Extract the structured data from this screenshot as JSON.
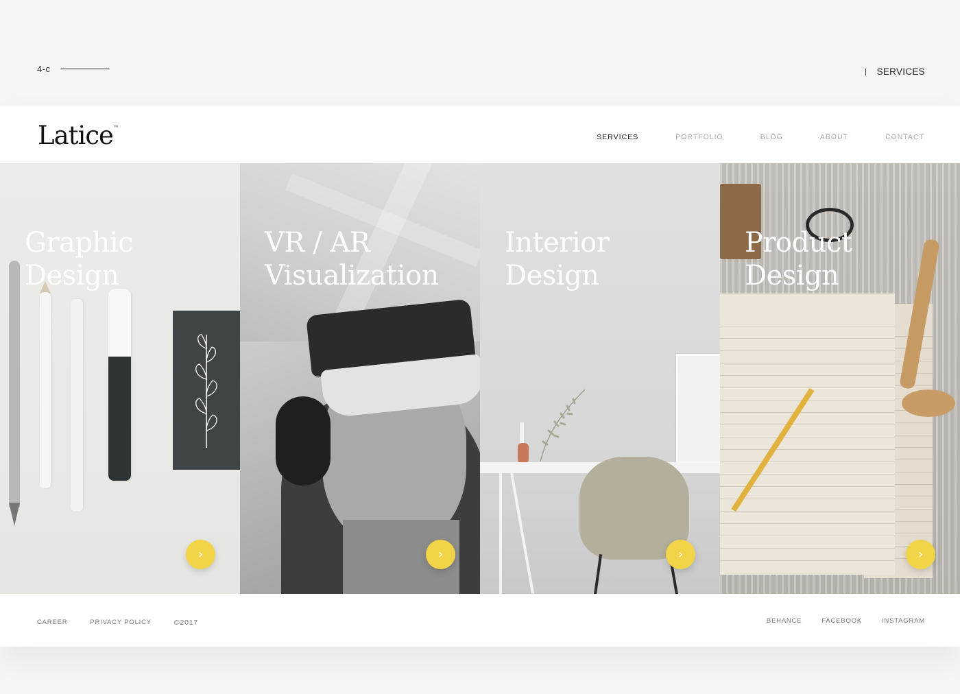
{
  "slide": {
    "code": "4-c",
    "section": "SERVICES"
  },
  "header": {
    "logo": "Latice",
    "logo_mark": "™",
    "nav": [
      {
        "label": "SERVICES",
        "active": true
      },
      {
        "label": "PORTFOLIO",
        "active": false
      },
      {
        "label": "BLOG",
        "active": false
      },
      {
        "label": "ABOUT",
        "active": false
      },
      {
        "label": "CONTACT",
        "active": false
      }
    ]
  },
  "panels": [
    {
      "title": "Graphic\nDesign",
      "button_icon": "chevron-right-icon"
    },
    {
      "title": "VR / AR\nVisualization",
      "button_icon": "chevron-right-icon"
    },
    {
      "title": "Interior\nDesign",
      "button_icon": "chevron-right-icon"
    },
    {
      "title": "Product\nDesign",
      "button_icon": "chevron-right-icon"
    }
  ],
  "footer": {
    "left": [
      "CAREER",
      "PRIVACY POLICY"
    ],
    "copyright": "©2017",
    "social": [
      "BEHANCE",
      "FACEBOOK",
      "INSTAGRAM"
    ]
  },
  "colors": {
    "accent": "#f2d448",
    "background": "#f5f5f5",
    "page": "#ffffff"
  }
}
